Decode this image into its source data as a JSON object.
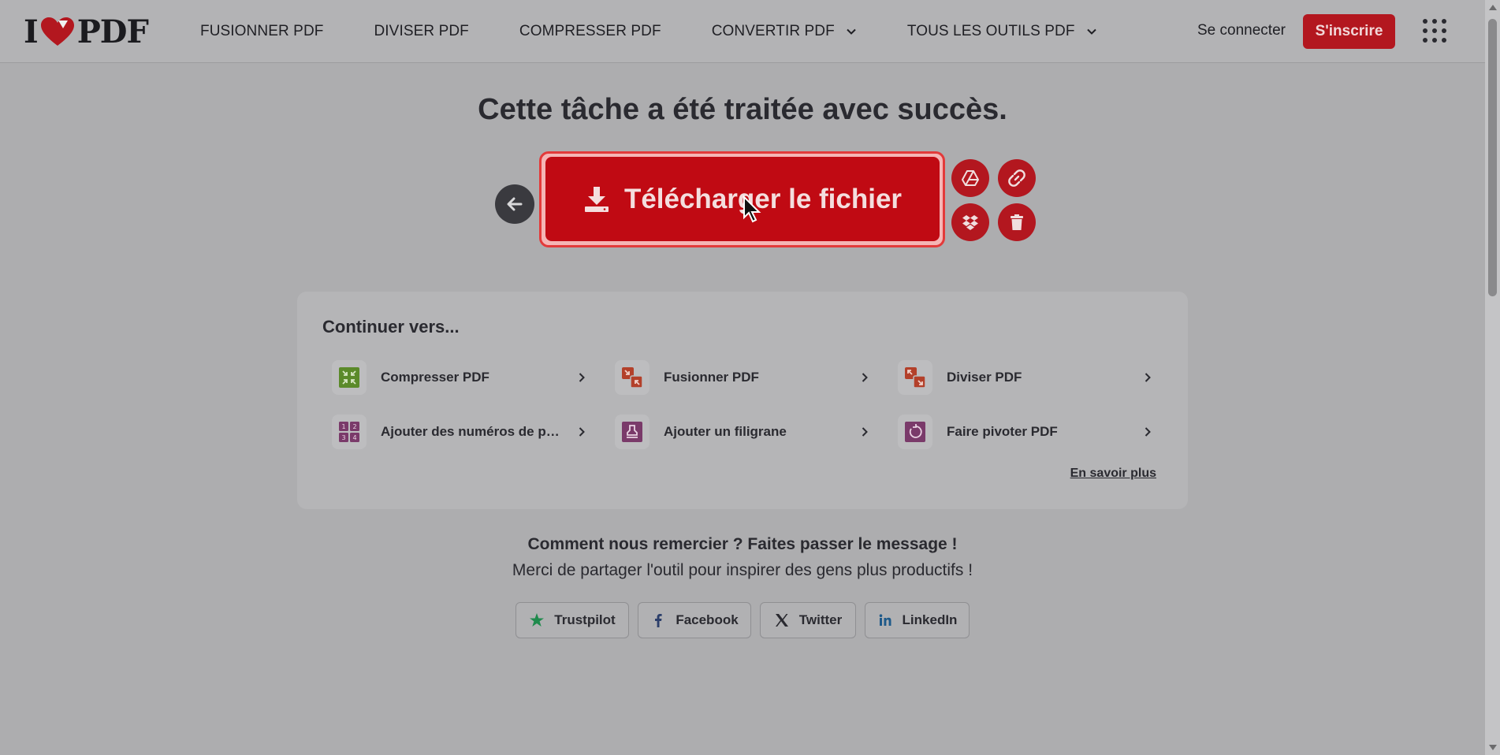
{
  "header": {
    "logo": {
      "left": "I",
      "right": "PDF"
    },
    "nav": [
      {
        "label": "FUSIONNER PDF"
      },
      {
        "label": "DIVISER PDF"
      },
      {
        "label": "COMPRESSER PDF"
      },
      {
        "label": "CONVERTIR PDF"
      },
      {
        "label": "TOUS LES OUTILS PDF"
      }
    ],
    "login_label": "Se connecter",
    "signup_label": "S'inscrire"
  },
  "main": {
    "headline": "Cette tâche a été traitée avec succès.",
    "download_label": "Télécharger le fichier"
  },
  "continue": {
    "title": "Continuer vers...",
    "tools": [
      {
        "label": "Compresser PDF",
        "icon": "compress-icon",
        "color": "#5b8a2a"
      },
      {
        "label": "Fusionner PDF",
        "icon": "merge-icon",
        "color": "#b3402a"
      },
      {
        "label": "Diviser PDF",
        "icon": "split-icon",
        "color": "#b3402a"
      },
      {
        "label": "Ajouter des numéros de pa...",
        "icon": "page-numbers-icon",
        "color": "#7a3a6a"
      },
      {
        "label": "Ajouter un filigrane",
        "icon": "watermark-icon",
        "color": "#7a3a6a"
      },
      {
        "label": "Faire pivoter PDF",
        "icon": "rotate-icon",
        "color": "#7a3a6a"
      }
    ],
    "learn_more": "En savoir plus"
  },
  "share": {
    "title": "Comment nous remercier ? Faites passer le message !",
    "subtitle": "Merci de partager l'outil pour inspirer des gens plus productifs !",
    "buttons": [
      {
        "label": "Trustpilot",
        "icon": "trustpilot-icon"
      },
      {
        "label": "Facebook",
        "icon": "facebook-icon"
      },
      {
        "label": "Twitter",
        "icon": "twitter-x-icon"
      },
      {
        "label": "LinkedIn",
        "icon": "linkedin-icon"
      }
    ]
  },
  "colors": {
    "brand_red": "#c00a13",
    "accent_red": "#b3171f"
  }
}
